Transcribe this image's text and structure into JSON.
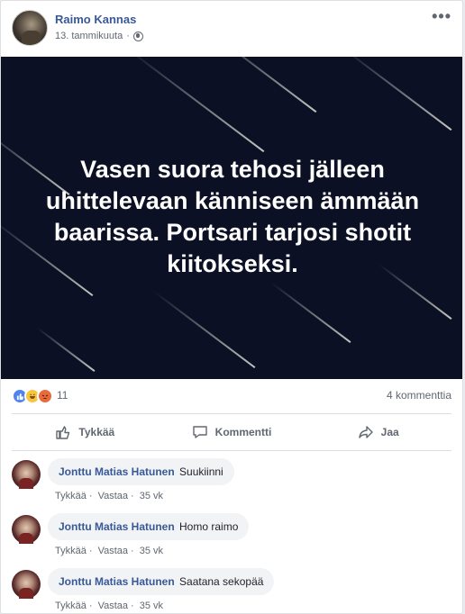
{
  "post": {
    "author": "Raimo Kannas",
    "date": "13. tammikuuta",
    "date_separator": "·",
    "more_icon": "more-dots-icon",
    "image_text": "Vasen suora tehosi jälleen uhittelevaan känniseen ämmään baarissa. Portsari tarjosi shotit kiitokseksi."
  },
  "reactions": {
    "count": "11",
    "comment_count": "4 kommenttia",
    "icons": [
      "like-reaction-icon",
      "haha-reaction-icon",
      "angry-reaction-icon"
    ]
  },
  "actions": {
    "like": "Tykkää",
    "comment": "Kommentti",
    "share": "Jaa"
  },
  "comments": [
    {
      "name": "Jonttu Matias Hatunen",
      "text": "Suukiinni",
      "like": "Tykkää",
      "reply": "Vastaa",
      "time": "35 vk"
    },
    {
      "name": "Jonttu Matias Hatunen",
      "text": "Homo raimo",
      "like": "Tykkää",
      "reply": "Vastaa",
      "time": "35 vk"
    },
    {
      "name": "Jonttu Matias Hatunen",
      "text": "Saatana sekopää",
      "like": "Tykkää",
      "reply": "Vastaa",
      "time": "35 vk"
    }
  ],
  "colors": {
    "link_blue": "#385898",
    "image_bg": "#0b1024",
    "like_blue": "#4f83f1"
  }
}
